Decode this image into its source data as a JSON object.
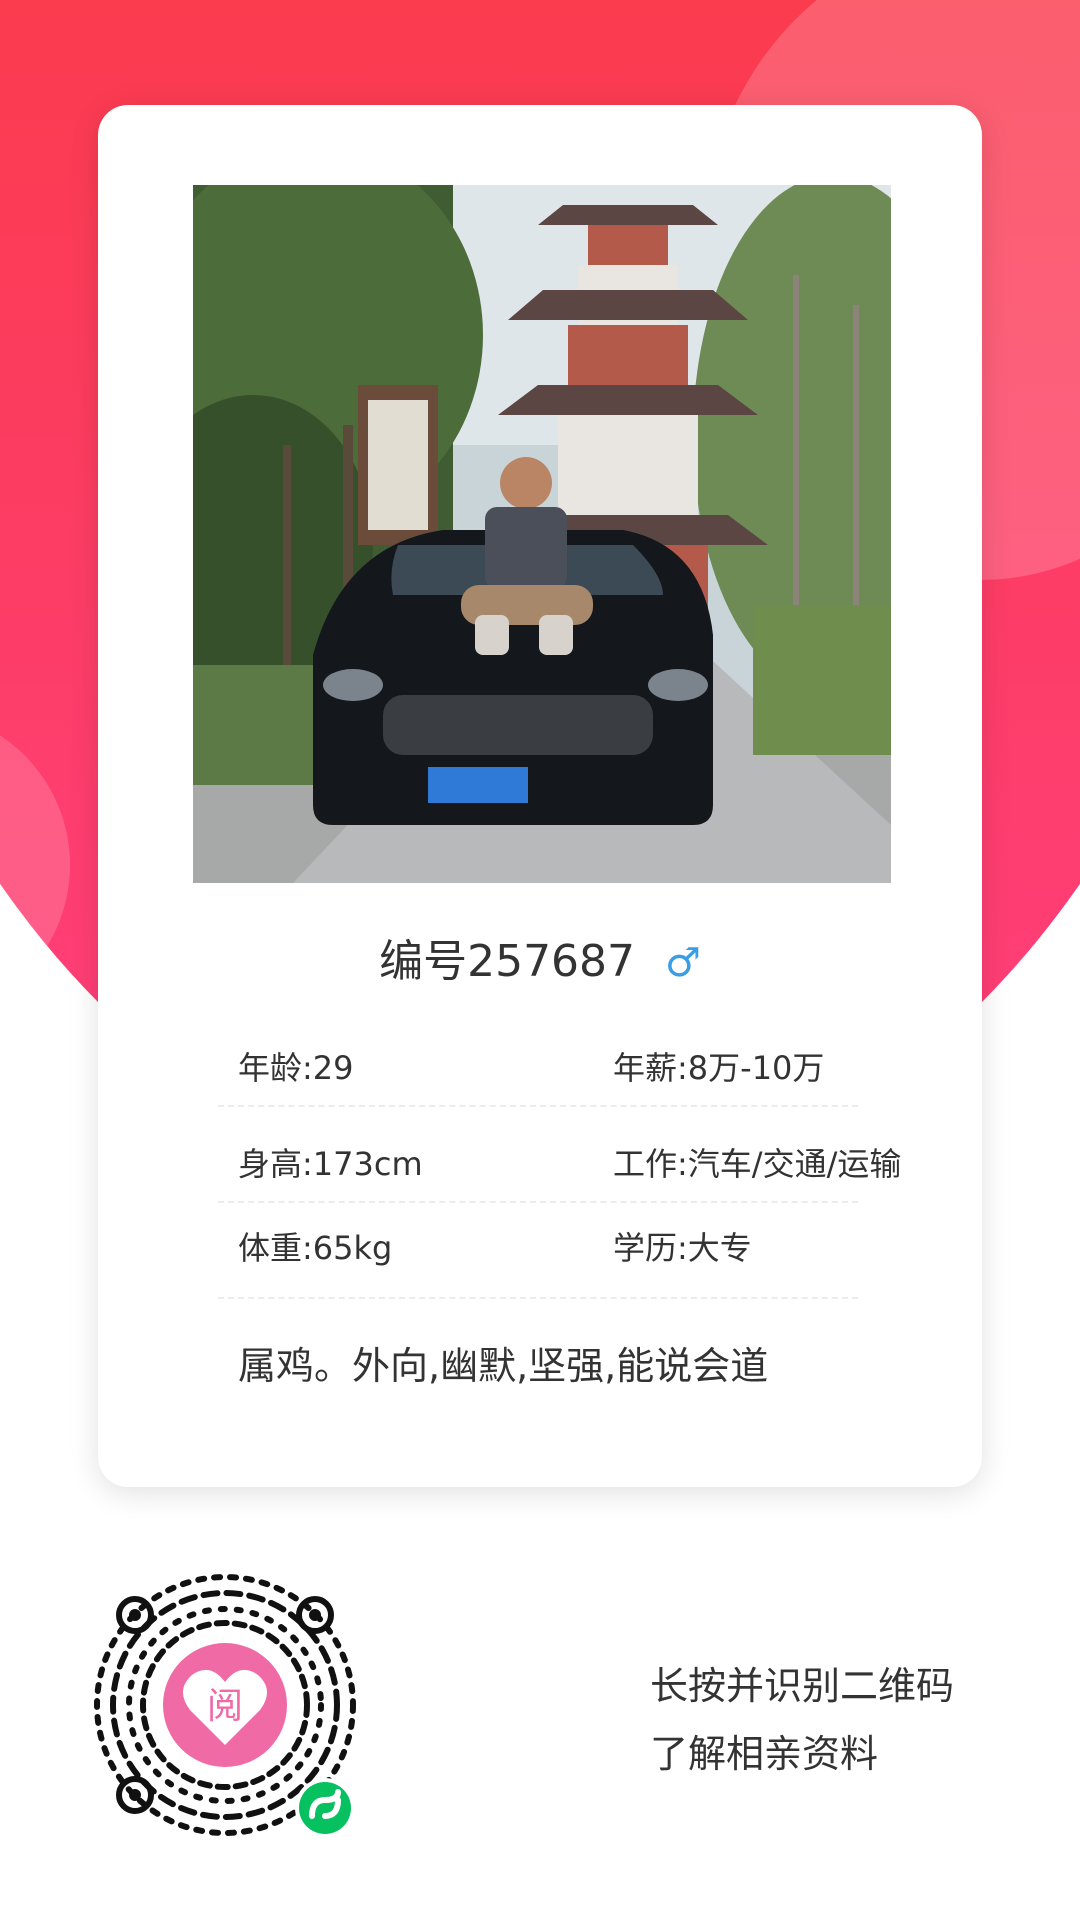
{
  "profile": {
    "id_label": "编号257687",
    "gender_icon": "male-symbol",
    "gender_glyph": "♂",
    "fields": [
      {
        "left": "年龄:29",
        "right": "年薪:8万-10万"
      },
      {
        "left": "身高:173cm",
        "right": "工作:汽车/交通/运输"
      },
      {
        "left": "体重:65kg",
        "right": "学历:大专"
      }
    ],
    "description": "属鸡。外向,幽默,坚强,能说会道"
  },
  "qr": {
    "line1": "长按并识别二维码",
    "line2": "了解相亲资料",
    "logo_glyph": "阅"
  },
  "colors": {
    "header_top": "#f7302e",
    "header_bottom": "#ff3f7e",
    "gender": "#3a9ee6",
    "qr_logo": "#f06aa6",
    "mini_program_badge": "#07c160"
  }
}
